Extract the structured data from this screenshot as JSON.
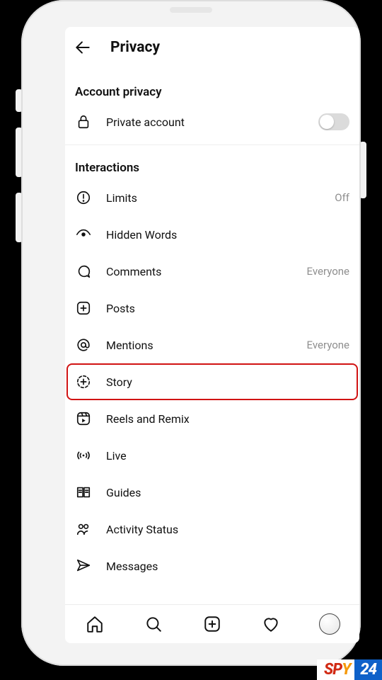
{
  "header": {
    "title": "Privacy"
  },
  "sections": {
    "account": {
      "title": "Account privacy",
      "private_label": "Private account",
      "private_on": false
    },
    "interactions": {
      "title": "Interactions",
      "items": {
        "limits": {
          "label": "Limits",
          "status": "Off"
        },
        "hidden": {
          "label": "Hidden Words",
          "status": ""
        },
        "comments": {
          "label": "Comments",
          "status": "Everyone"
        },
        "posts": {
          "label": "Posts",
          "status": ""
        },
        "mentions": {
          "label": "Mentions",
          "status": "Everyone"
        },
        "story": {
          "label": "Story",
          "status": ""
        },
        "reels": {
          "label": "Reels and Remix",
          "status": ""
        },
        "live": {
          "label": "Live",
          "status": ""
        },
        "guides": {
          "label": "Guides",
          "status": ""
        },
        "activity": {
          "label": "Activity Status",
          "status": ""
        },
        "messages": {
          "label": "Messages",
          "status": ""
        }
      }
    }
  },
  "highlight_item": "story",
  "watermark": {
    "brand_a": "SP",
    "brand_b": "Y",
    "brand_c": "24"
  }
}
